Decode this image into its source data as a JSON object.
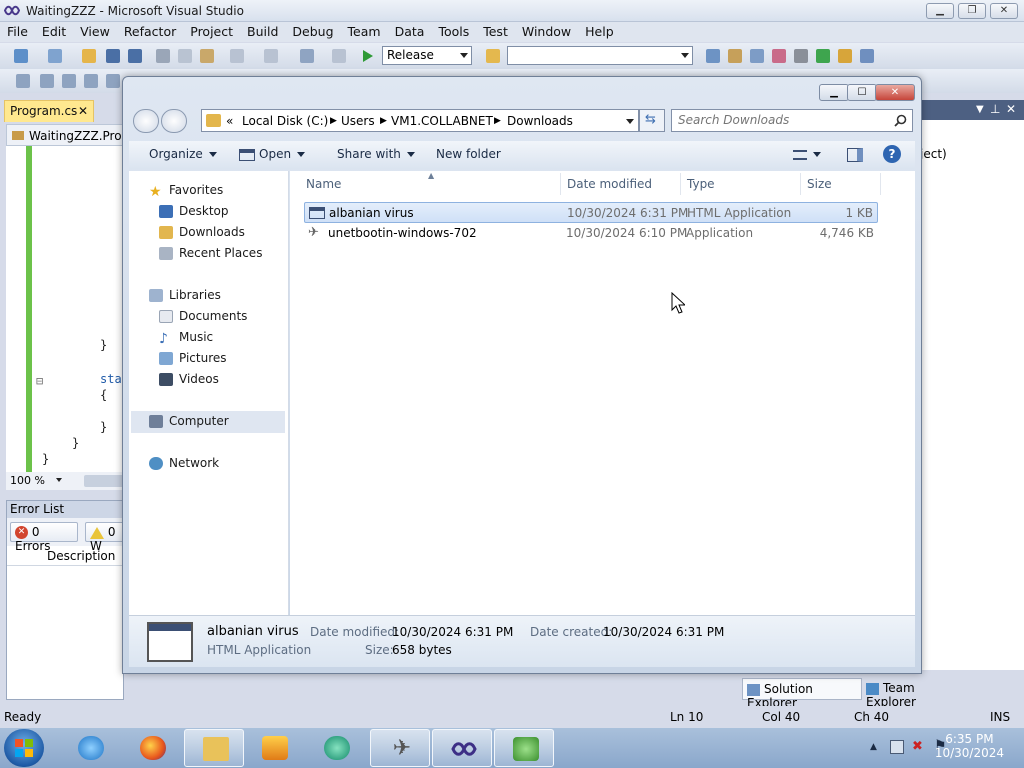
{
  "vs": {
    "title": "WaitingZZZ - Microsoft Visual Studio",
    "menu": [
      "File",
      "Edit",
      "View",
      "Refactor",
      "Project",
      "Build",
      "Debug",
      "Team",
      "Data",
      "Tools",
      "Test",
      "Window",
      "Help"
    ],
    "config_value": "Release",
    "platform_value": "",
    "doc_tab": "Program.cs",
    "nav_text": "WaitingZZZ.Progr",
    "code_lines": [
      "}",
      "sta",
      "{",
      "}",
      "}",
      "}"
    ],
    "zoom": "100 %",
    "error_list": {
      "title": "Error List",
      "errors": "0 Errors",
      "warnings": "0 W",
      "col_description": "Description"
    },
    "right_pane_text": "ject)",
    "panel_tabs": [
      "Solution Explorer",
      "Team Explorer"
    ],
    "status": {
      "ready": "Ready",
      "ln": "Ln 10",
      "col": "Col 40",
      "ch": "Ch 40",
      "ins": "INS"
    }
  },
  "explorer": {
    "breadcrumb": [
      "Local Disk (C:)",
      "Users",
      "VM1.COLLABNET",
      "Downloads"
    ],
    "search_placeholder": "Search Downloads",
    "commands": {
      "organize": "Organize",
      "open": "Open",
      "share": "Share with",
      "new_folder": "New folder"
    },
    "nav": {
      "favorites": "Favorites",
      "favorites_items": [
        "Desktop",
        "Downloads",
        "Recent Places"
      ],
      "libraries": "Libraries",
      "libraries_items": [
        "Documents",
        "Music",
        "Pictures",
        "Videos"
      ],
      "computer": "Computer",
      "network": "Network"
    },
    "columns": {
      "name": "Name",
      "date": "Date modified",
      "type": "Type",
      "size": "Size"
    },
    "files": [
      {
        "name": "albanian virus",
        "date": "10/30/2024 6:31 PM",
        "type": "HTML Application",
        "size": "1 KB",
        "selected": true
      },
      {
        "name": "unetbootin-windows-702",
        "date": "10/30/2024 6:10 PM",
        "type": "Application",
        "size": "4,746 KB",
        "selected": false
      }
    ],
    "details": {
      "name": "albanian virus",
      "type": "HTML Application",
      "date_modified_label": "Date modified:",
      "date_modified": "10/30/2024 6:31 PM",
      "date_created_label": "Date created:",
      "date_created": "10/30/2024 6:31 PM",
      "size_label": "Size:",
      "size": "658 bytes"
    }
  },
  "taskbar": {
    "time": "6:35 PM",
    "date": "10/30/2024"
  },
  "colors": {
    "accent": "#3399ff",
    "selection": "#cfe0f7",
    "vs_green": "#6cc24a",
    "tab_yellow": "#ffe88f"
  }
}
